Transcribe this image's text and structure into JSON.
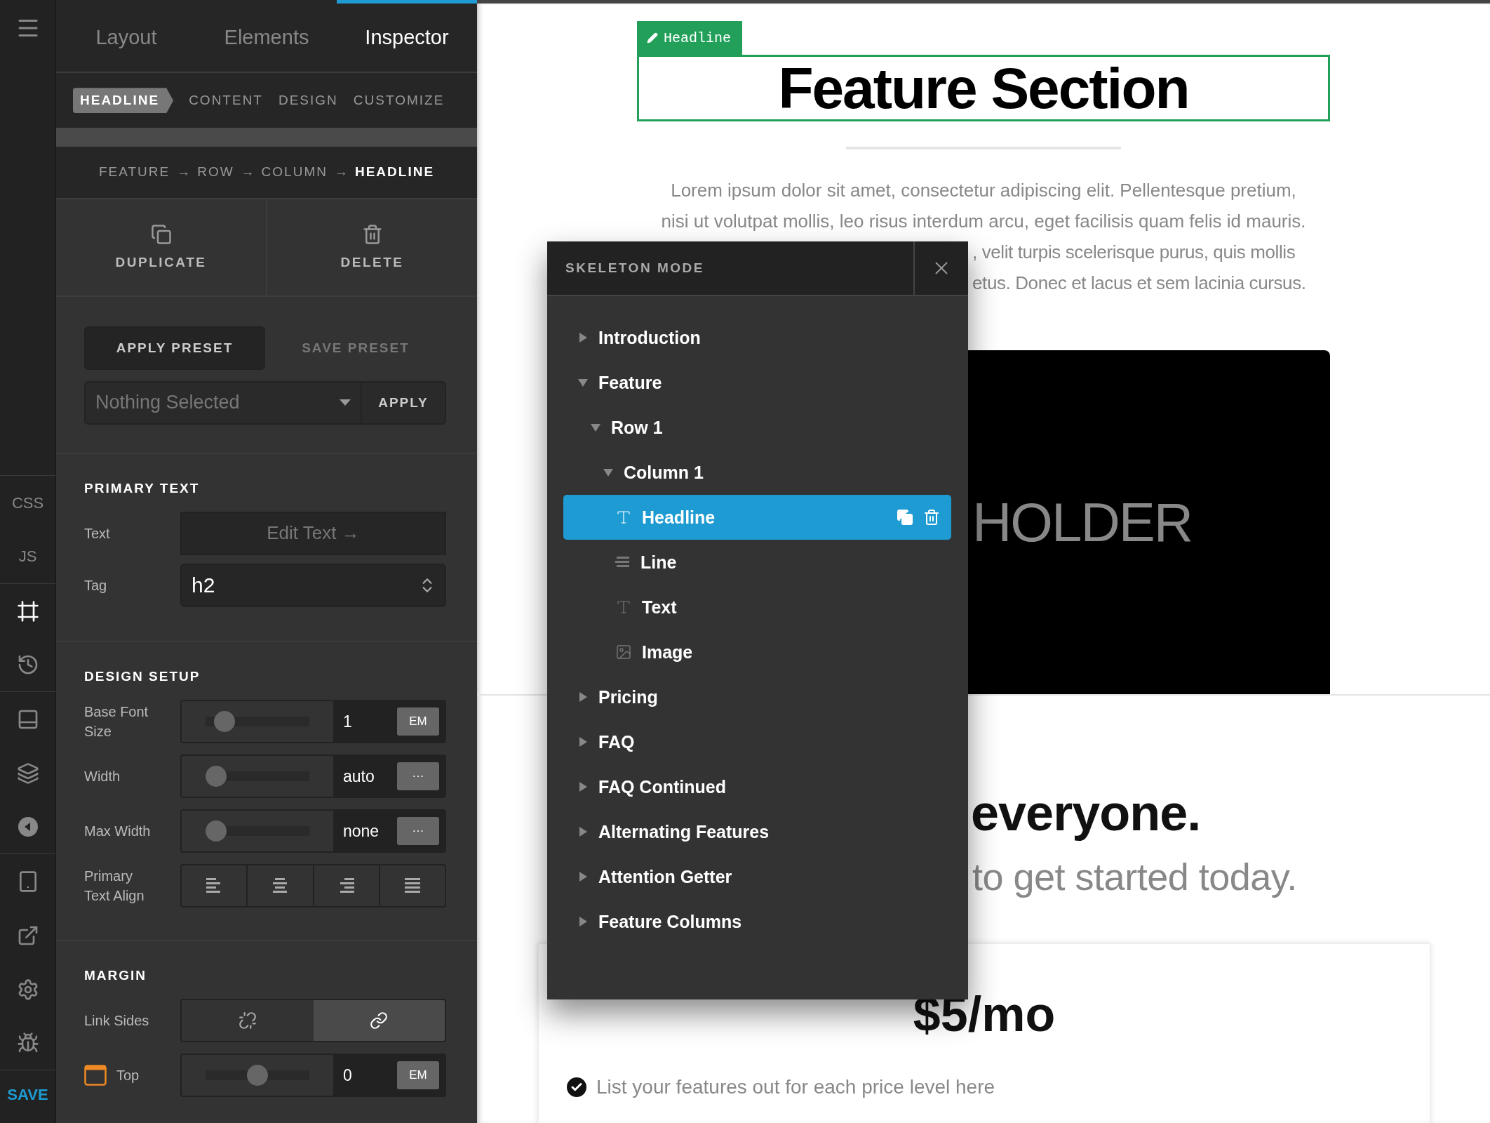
{
  "rail": {
    "top_labels": [
      {
        "label": "CSS"
      },
      {
        "label": "JS"
      }
    ],
    "tools": [
      {
        "selected": true
      },
      {
        "selected": false
      },
      {
        "selected": false
      },
      {
        "selected": false
      },
      {
        "selected": false
      },
      {
        "selected": false
      },
      {
        "selected": false
      },
      {
        "selected": false
      },
      {
        "selected": false
      }
    ],
    "save": "SAVE"
  },
  "panel": {
    "tabs": [
      {
        "label": "Layout",
        "selected": false
      },
      {
        "label": "Elements",
        "selected": false
      },
      {
        "label": "Inspector",
        "selected": true
      }
    ],
    "subtabs": [
      {
        "label": "HEADLINE",
        "selected": true
      },
      {
        "label": "CONTENT",
        "selected": false
      },
      {
        "label": "DESIGN",
        "selected": false
      },
      {
        "label": "CUSTOMIZE",
        "selected": false
      }
    ],
    "breadcrumb": [
      {
        "kind": "crumb",
        "label": "FEATURE",
        "selected": false
      },
      {
        "kind": "separator",
        "label": "→"
      },
      {
        "kind": "crumb",
        "label": "ROW",
        "selected": false
      },
      {
        "kind": "separator",
        "label": "→"
      },
      {
        "kind": "crumb",
        "label": "COLUMN",
        "selected": false
      },
      {
        "kind": "separator",
        "label": "→"
      },
      {
        "kind": "crumb",
        "label": "HEADLINE",
        "selected": true
      }
    ],
    "actions": [
      {
        "kind": "duplicate",
        "label": "DUPLICATE"
      },
      {
        "kind": "delete",
        "label": "DELETE"
      }
    ],
    "presets": {
      "apply_preset": "APPLY PRESET",
      "save_preset": "SAVE PRESET",
      "selection": "Nothing Selected",
      "apply": "APPLY"
    },
    "primary_text": {
      "title": "PRIMARY TEXT",
      "text_label": "Text",
      "edit_button": "Edit Text →",
      "tag_label": "Tag",
      "tag_value": "h2"
    },
    "design_setup": {
      "title": "DESIGN SETUP",
      "rows": [
        {
          "kind": "slider",
          "label": "Base Font Size",
          "level": 0.1,
          "value": "1",
          "unit": "EM"
        },
        {
          "kind": "slider",
          "label": "Width",
          "level": 0,
          "value": "auto",
          "unit": "···"
        },
        {
          "kind": "slider",
          "label": "Max Width",
          "level": 0,
          "value": "none",
          "unit": "···"
        },
        {
          "kind": "align",
          "label": "Primary Text Align"
        }
      ]
    },
    "margin": {
      "title": "MARGIN",
      "link_label": "Link Sides",
      "link_options": [
        {
          "kind": "unlink",
          "selected": false
        },
        {
          "kind": "link",
          "selected": true
        }
      ],
      "rows": [
        {
          "label": "Top",
          "level": 0.5,
          "value": "0",
          "unit": "EM"
        }
      ]
    }
  },
  "canvas": {
    "headline_badge": "Headline",
    "headline": "Feature Section",
    "paragraph_lines": [
      "Lorem ipsum dolor sit amet, consectetur adipiscing elit. Pellentesque pretium,",
      "nisi ut volutpat mollis, leo risus interdum arcu, eget facilisis quam felis id mauris."
    ],
    "paragraph_partial": [
      ", velit turpis scelerisque purus, quis mollis",
      "etus. Donec et lacus et sem lacinia cursus."
    ],
    "image_text": "HOLDER",
    "pricing_heading": "everyone.",
    "pricing_subheading": "to get started today.",
    "price": "$5/mo",
    "features": [
      {
        "text": "List your features out for each price level here",
        "checked": true
      }
    ]
  },
  "skeleton": {
    "title": "SKELETON MODE",
    "tree": [
      {
        "label": "Introduction",
        "expanded": false,
        "selected": false
      },
      {
        "label": "Feature",
        "expanded": true,
        "selected": false,
        "children": [
          {
            "label": "Row 1",
            "expanded": true,
            "selected": false,
            "children": [
              {
                "label": "Column 1",
                "expanded": true,
                "selected": false,
                "children": [
                  {
                    "label": "Headline",
                    "kind": "text",
                    "selected": true
                  },
                  {
                    "label": "Line",
                    "kind": "line",
                    "selected": false
                  },
                  {
                    "label": "Text",
                    "kind": "text",
                    "selected": false
                  },
                  {
                    "label": "Image",
                    "kind": "image",
                    "selected": false
                  }
                ]
              }
            ]
          }
        ]
      },
      {
        "label": "Pricing",
        "expanded": false,
        "selected": false
      },
      {
        "label": "FAQ",
        "expanded": false,
        "selected": false
      },
      {
        "label": "FAQ Continued",
        "expanded": false,
        "selected": false
      },
      {
        "label": "Alternating Features",
        "expanded": false,
        "selected": false
      },
      {
        "label": "Attention Getter",
        "expanded": false,
        "selected": false
      },
      {
        "label": "Feature Columns",
        "expanded": false,
        "selected": false
      }
    ]
  }
}
